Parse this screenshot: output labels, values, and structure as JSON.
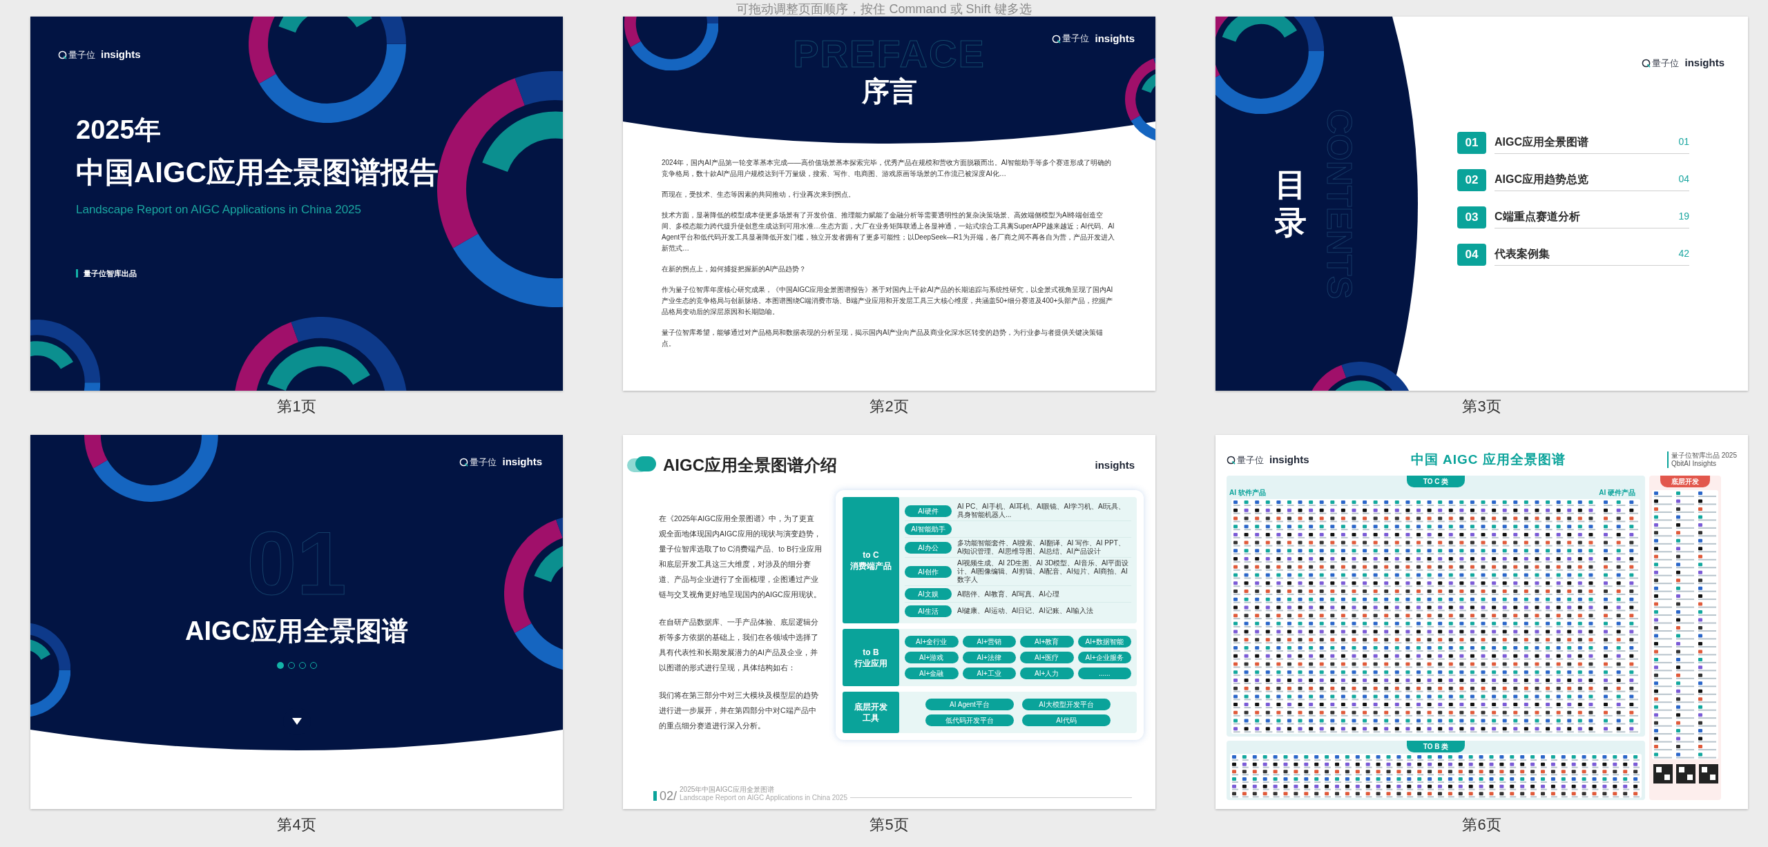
{
  "hint": "可拖动调整页面顺序，按住 Command 或 Shift 键多选",
  "pages": [
    {
      "kind": "cover",
      "label": "第1页",
      "logo": {
        "brand": "量子位",
        "sub": "insights"
      },
      "year": "2025年",
      "title": "中国AIGC应用全景图谱报告",
      "subtitle": "Landscape Report on AIGC Applications in China 2025",
      "publisher": "量子位智库出品"
    },
    {
      "kind": "preface",
      "label": "第2页",
      "logo": {
        "brand": "量子位",
        "sub": "insights"
      },
      "watermark": "PREFACE",
      "title": "序言",
      "paragraphs": [
        "2024年，国内AI产品第一轮变革基本完成——高价值场景基本探索完毕，优秀产品在规模和营收方面脱颖而出。AI智能助手等多个赛道形成了明确的竞争格局，数十款AI产品用户规模达到千万量级，搜索、写作、电商图、游戏原画等场景的工作流已被深度AI化…",
        "而现在，受技术、生态等因素的共同推动，行业再次来到拐点。",
        "技术方面，显著降低的模型成本使更多场景有了开发价值、推理能力赋能了金融分析等需要透明性的复杂决策场景、高效端侧模型为AI终端创造空间、多模态能力跨代提升使创意生成达到可用水准…生态方面，大厂在业务矩阵联通上各显神通，一站式综合工具离SuperAPP越来越近；AI代码、AI Agent平台和低代码开发工具显著降低开发门槛，独立开发者拥有了更多可能性；以DeepSeek—R1为开端，各厂商之间不再各自为营，产品开发进入新范式…",
        "在新的拐点上，如何捕捉把握新的AI产品趋势？",
        "作为量子位智库年度核心研究成果，《中国AIGC应用全景图谱报告》基于对国内上千款AI产品的长期追踪与系统性研究，以全景式视角呈现了国内AI产业生态的竞争格局与创新脉络。本图谱围绕C端消费市场、B端产业应用和开发层工具三大核心维度，共涵盖50+细分赛道及400+头部产品，挖掘产品格局变动后的深层原因和长期隐喻。",
        "量子位智库希望，能够通过对产品格局和数据表现的分析呈现，揭示国内AI产业向产品及商业化深水区转变的趋势，为行业参与者提供关键决策锚点。"
      ]
    },
    {
      "kind": "contents",
      "label": "第3页",
      "logo": {
        "brand": "量子位",
        "sub": "insights"
      },
      "title": "目录",
      "watermark": "CONTENTS",
      "entries": [
        {
          "num": "01",
          "title": "AIGC应用全景图谱",
          "page": "01"
        },
        {
          "num": "02",
          "title": "AIGC应用趋势总览",
          "page": "04"
        },
        {
          "num": "03",
          "title": "C端重点赛道分析",
          "page": "19"
        },
        {
          "num": "04",
          "title": "代表案例集",
          "page": "42"
        }
      ]
    },
    {
      "kind": "section",
      "label": "第4页",
      "logo": {
        "brand": "量子位",
        "sub": "insights"
      },
      "number": "01",
      "title": "AIGC应用全景图谱",
      "dots": [
        {
          "selected": true
        },
        {
          "selected": false
        },
        {
          "selected": false
        },
        {
          "selected": false
        }
      ]
    },
    {
      "kind": "intro",
      "label": "第5页",
      "logo": {
        "sub": "insights"
      },
      "title": "AIGC应用全景图谱介绍",
      "paragraphs": [
        "在《2025年AIGC应用全景图谱》中，为了更直观全面地体现国内AIGC应用的现状与演变趋势，量子位智库选取了to C消费端产品、to B行业应用和底层开发工具这三大维度，对涉及的细分赛道、产品与企业进行了全面梳理，企图通过产业链与交叉视角更好地呈现国内的AIGC应用现状。",
        "在自研产品数据库、一手产品体验、底层逻辑分析等多方依据的基础上，我们在各领域中选择了具有代表性和长期发展潜力的AI产品及企业，并以图谱的形式进行呈现，具体结构如右：",
        "我们将在第三部分中对三大模块及模型层的趋势进行进一步展开，并在第四部分中对C端产品中的重点细分赛道进行深入分析。"
      ],
      "groups": [
        {
          "kind": "list",
          "name": [
            "to C",
            "消费端产品"
          ],
          "rows": [
            {
              "tag": "AI硬件",
              "text": "AI PC、AI手机、AI耳机、AI眼镜、AI学习机、AI玩具、具身智能机器人..."
            },
            {
              "tag": "AI智能助手"
            },
            {
              "tag": "AI办公",
              "text": "多功能智能套件、AI搜索、AI翻译、AI 写作、AI PPT、AI知识管理、AI思维导图、AI总结、AI产品设计"
            },
            {
              "tag": "AI创作",
              "text": "AI视频生成、AI 2D生图、AI 3D模型、AI音乐、AI平面设计、AI图像编辑、AI剪辑、AI配音、AI短片、AI商拍、AI数字人"
            },
            {
              "tag": "AI文娱",
              "text": "AI陪伴、AI教育、AI写真、AI心理"
            },
            {
              "tag": "AI生活",
              "text": "AI健康、AI运动、AI日记、AI记账、AI输入法"
            }
          ]
        },
        {
          "kind": "pills4",
          "name": [
            "to B",
            "行业应用"
          ],
          "pills": [
            "AI+全行业",
            "AI+营销",
            "AI+教育",
            "AI+数据智能",
            "AI+游戏",
            "AI+法律",
            "AI+医疗",
            "AI+企业服务",
            "AI+金融",
            "AI+工业",
            "AI+人力",
            "......"
          ]
        },
        {
          "kind": "pills2",
          "name": [
            "底层开发",
            "工具"
          ],
          "pills": [
            "AI Agent平台",
            "AI大模型开发平台",
            "低代码开发平台",
            "AI代码"
          ]
        }
      ],
      "footer": {
        "num": "02/",
        "title": "2025年中国AIGC应用全景图谱",
        "subtitle": "Landscape Report on AIGC Applications in China 2025"
      }
    },
    {
      "kind": "map",
      "label": "第6页",
      "logo": {
        "brand": "量子位",
        "sub": "insights"
      },
      "title": "中国 AIGC 应用全景图谱",
      "info": [
        "量子位智库出品 2025",
        "QbitAI Insights"
      ],
      "toc": "TO C 类",
      "toc_left": "AI 软件产品",
      "toc_right": "AI 硬件产品",
      "tob": "TO B 类",
      "dev": "底层开发"
    }
  ]
}
